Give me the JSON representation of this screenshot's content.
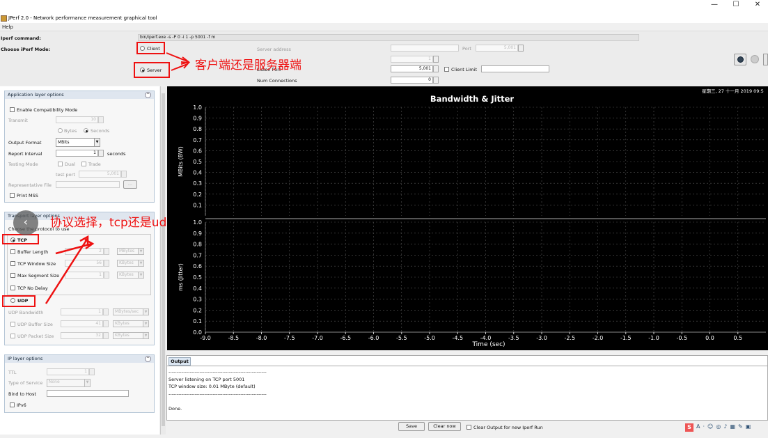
{
  "window": {
    "title": "JPerf 2.0 - Network performance measurement graphical tool",
    "minimize": "—",
    "maximize": "☐",
    "close": "✕"
  },
  "menu": {
    "help": "Help"
  },
  "top": {
    "iperf_command_label": "Iperf command:",
    "iperf_command_value": "bin/iperf.exe -s -P 0 -i 1 -p 5001 -f m",
    "choose_mode_label": "Choose iPerf Mode:",
    "client_label": "Client",
    "server_label": "Server",
    "server_address_label": "Server address",
    "port_label": "Port",
    "port_value": "5,001",
    "parallel_value": "1",
    "listen_port_label": "Listen Port",
    "listen_port_value": "5,001",
    "client_limit_label": "Client Limit",
    "num_connections_label": "Num Connections",
    "num_connections_value": "0",
    "mode": "server"
  },
  "annotations": {
    "mode_note": "客户端还是服务器端",
    "protocol_note": "协议选择，tcp还是udp"
  },
  "app_layer": {
    "title": "Application layer options",
    "compat_mode": "Enable Compatibility Mode",
    "transmit_label": "Transmit",
    "transmit_value": "10",
    "bytes_label": "Bytes",
    "seconds_label": "Seconds",
    "output_format_label": "Output Format",
    "output_format_value": "MBits",
    "report_interval_label": "Report Interval",
    "report_interval_value": "1",
    "report_interval_unit": "seconds",
    "testing_mode_label": "Testing Mode",
    "dual_label": "Dual",
    "trade_label": "Trade",
    "test_port_label": "test port",
    "test_port_value": "5,001",
    "rep_file_label": "Representative File",
    "browse_label": "...",
    "print_mss_label": "Print MSS"
  },
  "transport": {
    "title": "Transport layer options",
    "choose_protocol": "Choose the protocol to use",
    "tcp_label": "TCP",
    "buffer_length_label": "Buffer Length",
    "buffer_length_value": "2",
    "buffer_length_unit": "MBytes",
    "window_size_label": "TCP Window Size",
    "window_size_value": "56",
    "window_size_unit": "KBytes",
    "mss_label": "Max Segment Size",
    "mss_value": "1",
    "mss_unit": "KBytes",
    "no_delay_label": "TCP No Delay",
    "udp_label": "UDP",
    "udp_bw_label": "UDP Bandwidth",
    "udp_bw_value": "1",
    "udp_bw_unit": "MBytes/sec",
    "udp_buf_label": "UDP Buffer Size",
    "udp_buf_value": "41",
    "udp_buf_unit": "KBytes",
    "udp_pkt_label": "UDP Packet Size",
    "udp_pkt_value": "32",
    "udp_pkt_unit": "KBytes",
    "protocol": "tcp"
  },
  "ip_layer": {
    "title": "IP layer options",
    "ttl_label": "TTL",
    "ttl_value": "1",
    "tos_label": "Type of Service",
    "tos_value": "None",
    "bind_label": "Bind to Host",
    "ipv6_label": "IPv6"
  },
  "chart_data": {
    "type": "line",
    "title": "Bandwidth & Jitter",
    "timestamp": "星期三, 27 十一月 2019 09:5",
    "xlabel": "Time (sec)",
    "xlim": [
      -9.0,
      1.0
    ],
    "x_ticks": [
      "-9.0",
      "-8.5",
      "-8.0",
      "-7.5",
      "-7.0",
      "-6.5",
      "-6.0",
      "-5.5",
      "-5.0",
      "-4.5",
      "-4.0",
      "-3.5",
      "-3.0",
      "-2.5",
      "-2.0",
      "-1.5",
      "-1.0",
      "-0.5",
      "0.0",
      "0.5"
    ],
    "panels": [
      {
        "ylabel": "MBits (BW)",
        "ylim": [
          0,
          1.0
        ],
        "y_ticks": [
          "1.0",
          "0.9",
          "0.8",
          "0.7",
          "0.6",
          "0.5",
          "0.4",
          "0.3",
          "0.2",
          "0.1"
        ]
      },
      {
        "ylabel": "ms (Jitter)",
        "ylim": [
          0,
          1.0
        ],
        "y_ticks": [
          "1.0",
          "0.9",
          "0.8",
          "0.7",
          "0.6",
          "0.5",
          "0.4",
          "0.3",
          "0.2",
          "0.1",
          "0.0"
        ]
      }
    ],
    "series": [],
    "grid": true,
    "colors": {
      "background": "#000000",
      "grid": "#555555",
      "text": "#ffffff"
    }
  },
  "output": {
    "tab_label": "Output",
    "lines": [
      "------------------------------------------------------------",
      "Server listening on TCP port 5001",
      "TCP window size: 0.01 MByte (default)",
      "------------------------------------------------------------",
      "",
      "Done."
    ]
  },
  "bottom": {
    "save_label": "Save",
    "clear_label": "Clear now",
    "clear_option_label": "Clear Output for new Iperf Run"
  }
}
